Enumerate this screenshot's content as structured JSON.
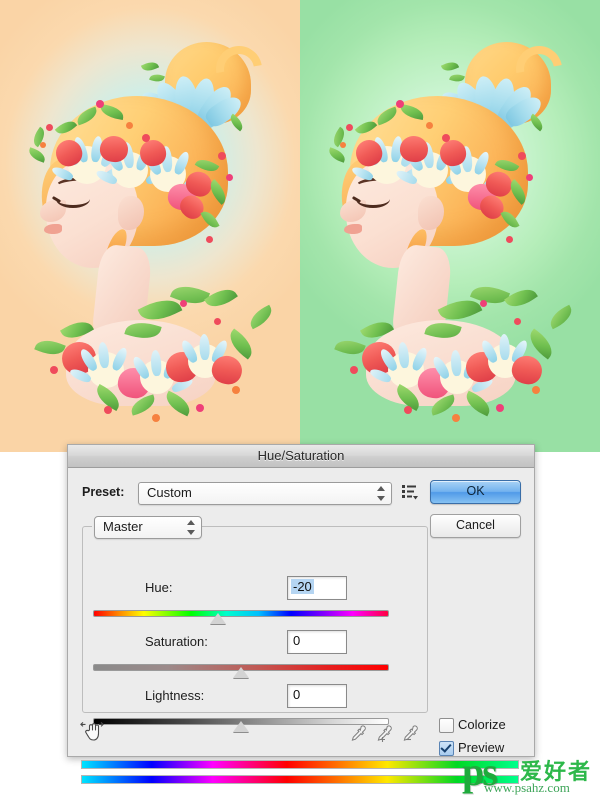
{
  "window": {
    "title": "Hue/Saturation"
  },
  "preset": {
    "label": "Preset:",
    "value": "Custom",
    "menu_icon": "preset-options-icon",
    "stepper_icon": "updown-stepper-icon"
  },
  "buttons": {
    "ok": "OK",
    "cancel": "Cancel"
  },
  "channel": {
    "value": "Master"
  },
  "sliders": [
    {
      "label": "Hue:",
      "value": "-20",
      "selected": true,
      "thumb_percent": 40,
      "track_name": "hue-slider-track"
    },
    {
      "label": "Saturation:",
      "value": "0",
      "selected": false,
      "thumb_percent": 50,
      "track_name": "saturation-slider-track"
    },
    {
      "label": "Lightness:",
      "value": "0",
      "selected": false,
      "thumb_percent": 50,
      "track_name": "lightness-slider-track"
    }
  ],
  "checkboxes": {
    "colorize": {
      "label": "Colorize",
      "checked": false
    },
    "preview": {
      "label": "Preview",
      "checked": true
    }
  },
  "tools": {
    "scrubby_hand": "scrubby-slider-hand-icon",
    "eyedroppers": [
      {
        "name": "eyedropper-icon",
        "modifier": ""
      },
      {
        "name": "eyedropper-add-icon",
        "modifier": "+"
      },
      {
        "name": "eyedropper-subtract-icon",
        "modifier": "−"
      }
    ]
  },
  "spectrum": {
    "top_bar_name": "source-hue-spectrum-bar",
    "bottom_bar_name": "result-hue-spectrum-bar"
  },
  "previews": {
    "before": {
      "name": "original-artwork",
      "background_edge": "#fad4a6",
      "background_center": "#bdf0f3"
    },
    "after": {
      "name": "hue-shifted-artwork",
      "background_edge": "#98e0a4",
      "background_center": "#ddfbe2"
    },
    "subject": "girl in profile with flower crown"
  },
  "watermark": {
    "logo": "ps",
    "chinese": "爱好者",
    "url": "www.psahz.com",
    "color": "#2db84a"
  }
}
